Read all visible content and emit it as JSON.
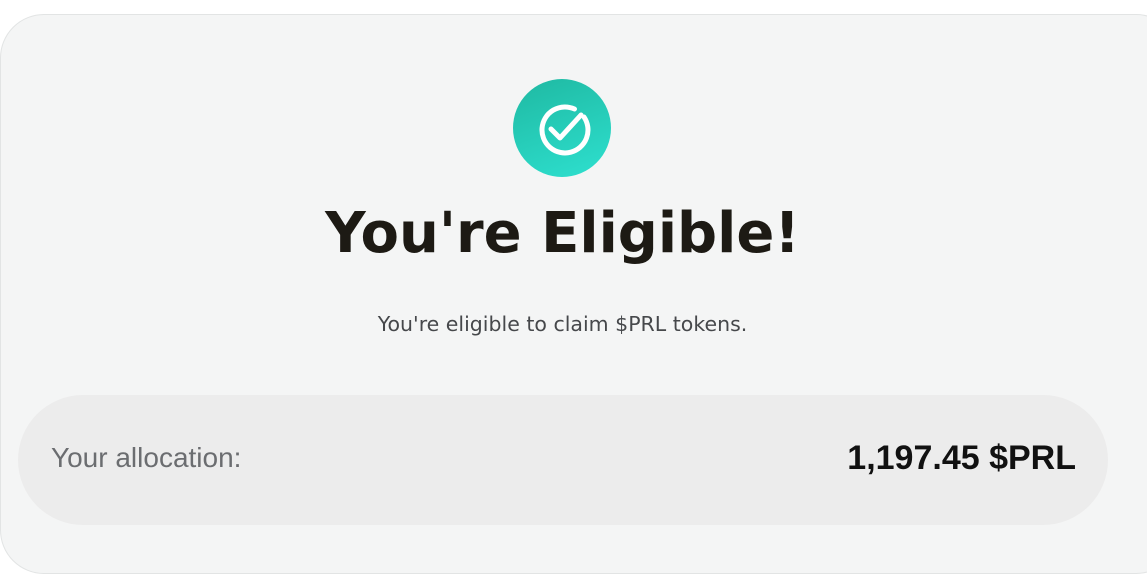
{
  "status": {
    "icon": "check-circle-icon",
    "title": "You're Eligible!",
    "subtitle": "You're eligible to claim $PRL tokens."
  },
  "allocation": {
    "label": "Your allocation:",
    "value": "1,197.45 $PRL"
  },
  "colors": {
    "accent_start": "#1fb9a2",
    "accent_end": "#2ee0cf",
    "card_background": "#f4f5f5",
    "pill_background": "#ececec"
  }
}
